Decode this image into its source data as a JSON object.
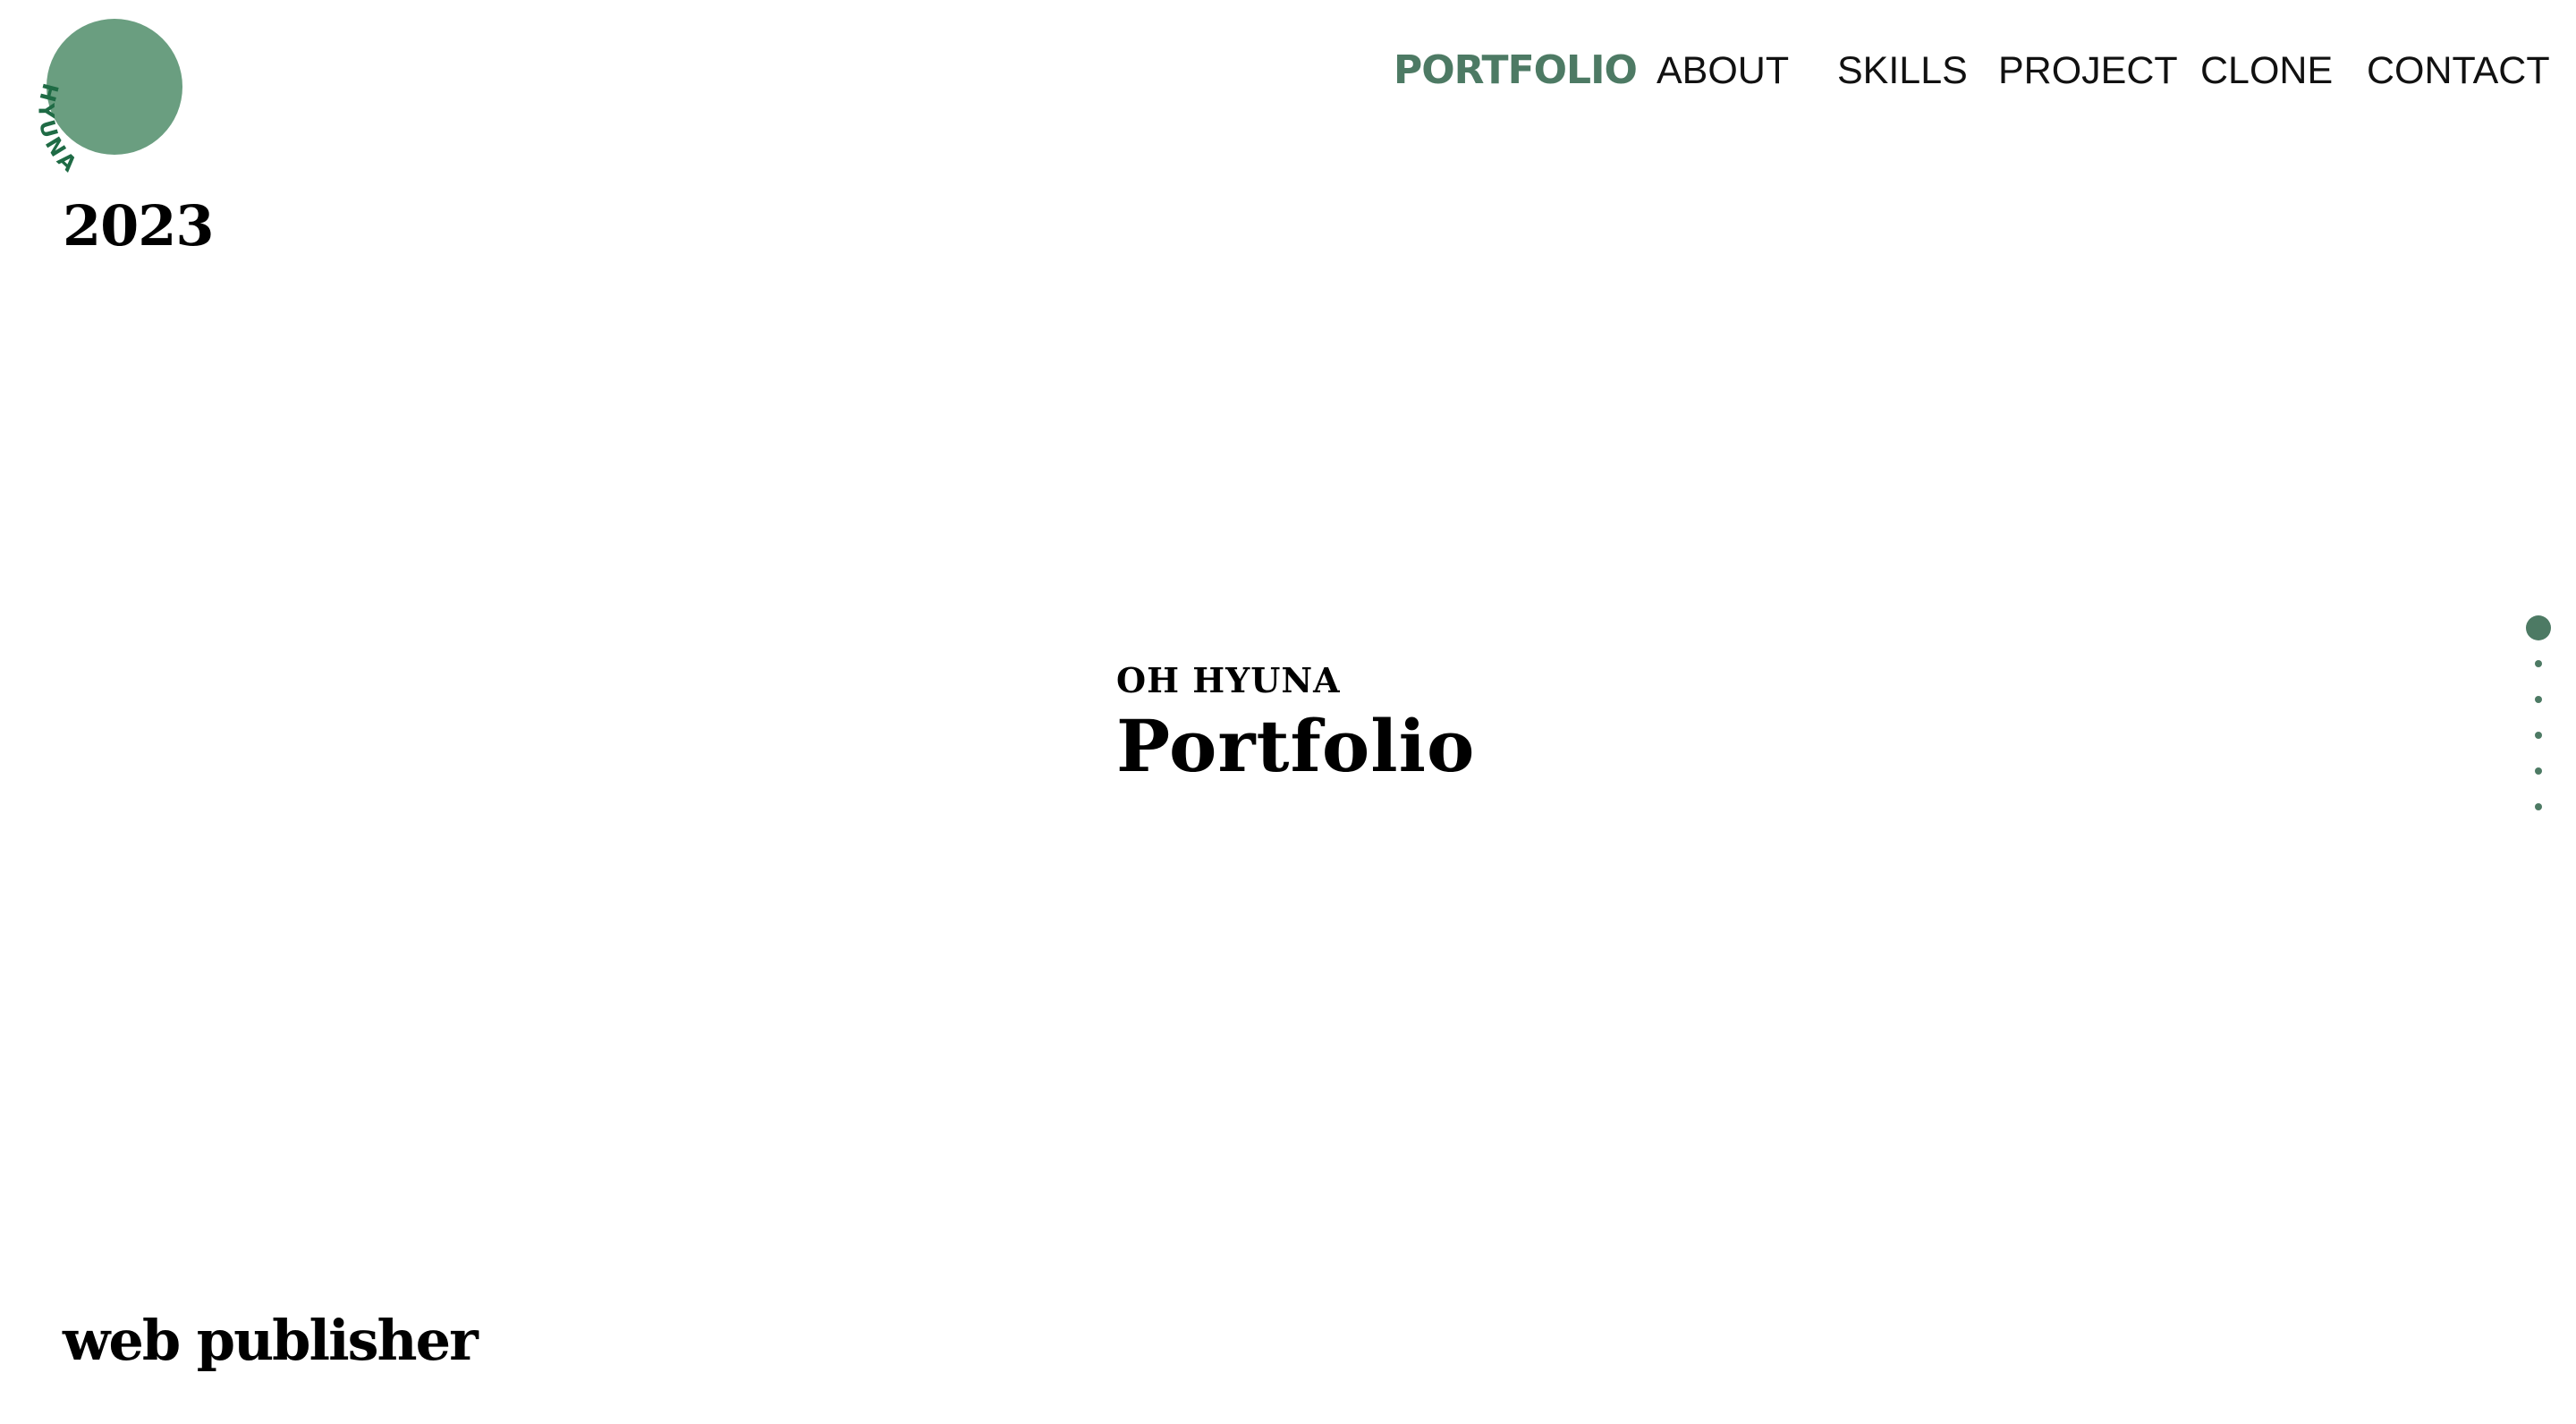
{
  "brand": {
    "logo_text": "HYUNA",
    "logo_color": "#6a9e80",
    "logo_text_color": "#1f6b45"
  },
  "header": {
    "year": "2023"
  },
  "nav": {
    "items": [
      {
        "label": "PORTFOLIO",
        "active": true,
        "color": "#4d7a64"
      },
      {
        "label": "ABOUT",
        "active": false
      },
      {
        "label": "SKILLS",
        "active": false
      },
      {
        "label": "PROJECT",
        "active": false
      },
      {
        "label": "CLONE",
        "active": false
      },
      {
        "label": "CONTACT",
        "active": false
      }
    ]
  },
  "hero": {
    "subtitle": "OH HYUNA",
    "title": "Portfolio"
  },
  "section_nav": {
    "count": 6,
    "active_index": 0,
    "color": "#4d7a64"
  },
  "footer": {
    "role": "web publisher"
  }
}
